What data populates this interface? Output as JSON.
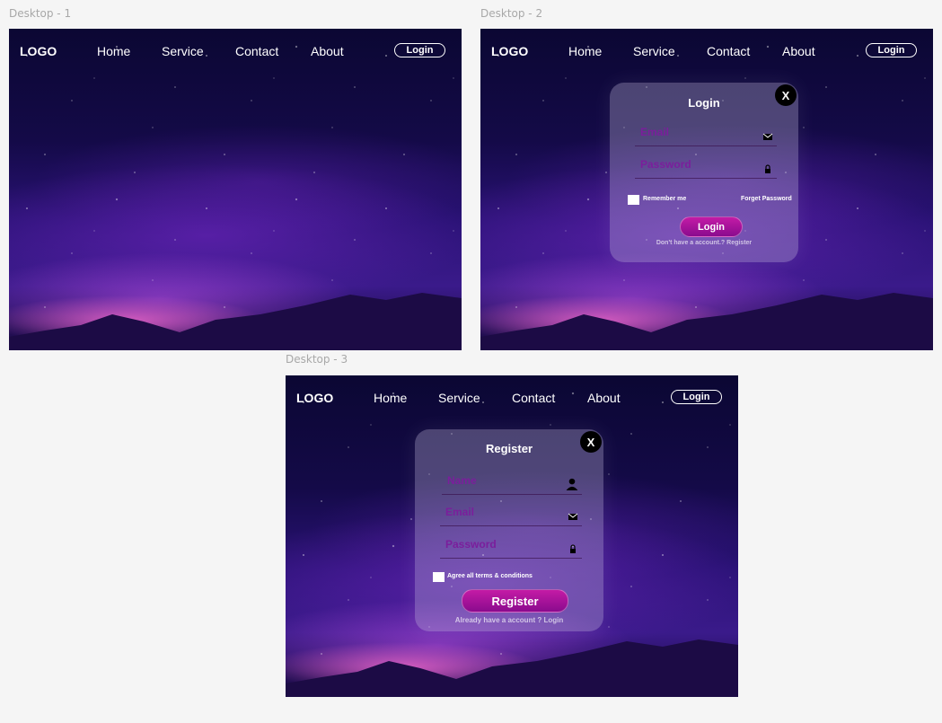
{
  "frames": {
    "desktop1": {
      "label": "Desktop - 1"
    },
    "desktop2": {
      "label": "Desktop - 2"
    },
    "desktop3": {
      "label": "Desktop - 3"
    }
  },
  "nav": {
    "logo": "LOGO",
    "home": "Home",
    "service": "Service",
    "contact": "Contact",
    "about": "About",
    "login": "Login"
  },
  "login_modal": {
    "title": "Login",
    "close": "X",
    "email_label": "Email",
    "password_label": "Password",
    "remember_me": "Remember me",
    "forgot_password": "Forget Password",
    "submit": "Login",
    "footer": "Don't have a account.?  Register"
  },
  "register_modal": {
    "title": "Register",
    "close": "X",
    "name_label": "Name",
    "email_label": "Email",
    "password_label": "Password",
    "agree": "Agree all terms & conditions",
    "submit": "Register",
    "footer": "Already have a account ?  Login"
  },
  "icons": {
    "close": "close-icon",
    "mail": "mail-icon",
    "lock": "lock-icon",
    "user": "user-icon"
  },
  "colors": {
    "field_label": "#7b1e9c",
    "button_top": "#c41ba6",
    "button_bottom": "#8a0b8e"
  }
}
